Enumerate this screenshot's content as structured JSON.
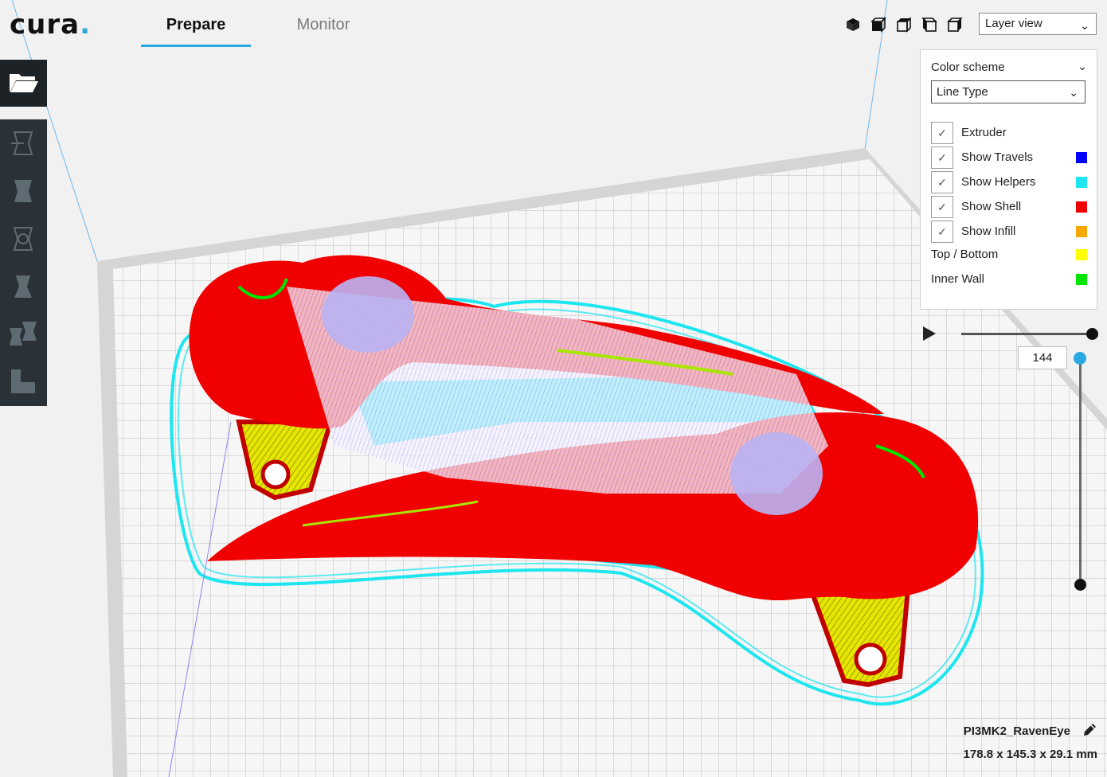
{
  "app": {
    "logo_text": "cura",
    "logo_dot": "."
  },
  "tabs": [
    {
      "label": "Prepare",
      "active": true
    },
    {
      "label": "Monitor",
      "active": false
    }
  ],
  "view_buttons": [
    "3d-view-icon",
    "front-view-icon",
    "top-view-icon",
    "left-view-icon",
    "right-view-icon"
  ],
  "view_select": {
    "value": "Layer view"
  },
  "toolbar": {
    "open_icon": "folder-open-icon",
    "tools": [
      "move-icon",
      "scale-icon",
      "rotate-icon",
      "mirror-icon",
      "per-model-settings-icon",
      "support-blocker-icon"
    ]
  },
  "color_panel": {
    "title": "Color scheme",
    "scheme_value": "Line Type",
    "checkbox_rows": [
      {
        "label": "Extruder",
        "checked": true,
        "color": ""
      },
      {
        "label": "Show Travels",
        "checked": true,
        "color": "#0000ff"
      },
      {
        "label": "Show Helpers",
        "checked": true,
        "color": "#1ee6f0"
      },
      {
        "label": "Show Shell",
        "checked": true,
        "color": "#f00000"
      },
      {
        "label": "Show Infill",
        "checked": true,
        "color": "#f5a800"
      }
    ],
    "legend_rows": [
      {
        "label": "Top / Bottom",
        "color": "#ffff00"
      },
      {
        "label": "Inner Wall",
        "color": "#00e600"
      }
    ]
  },
  "layer_slider": {
    "current_layer": "144"
  },
  "job": {
    "name": "PI3MK2_RavenEye",
    "dimensions": "178.8 x 145.3 x 29.1 mm"
  },
  "colors": {
    "accent": "#2aa8e2",
    "shell": "#f00000",
    "helpers": "#1ee6f0",
    "travels": "#a9a0f0",
    "infill": "#f5d000",
    "inner_wall": "#00e600"
  }
}
